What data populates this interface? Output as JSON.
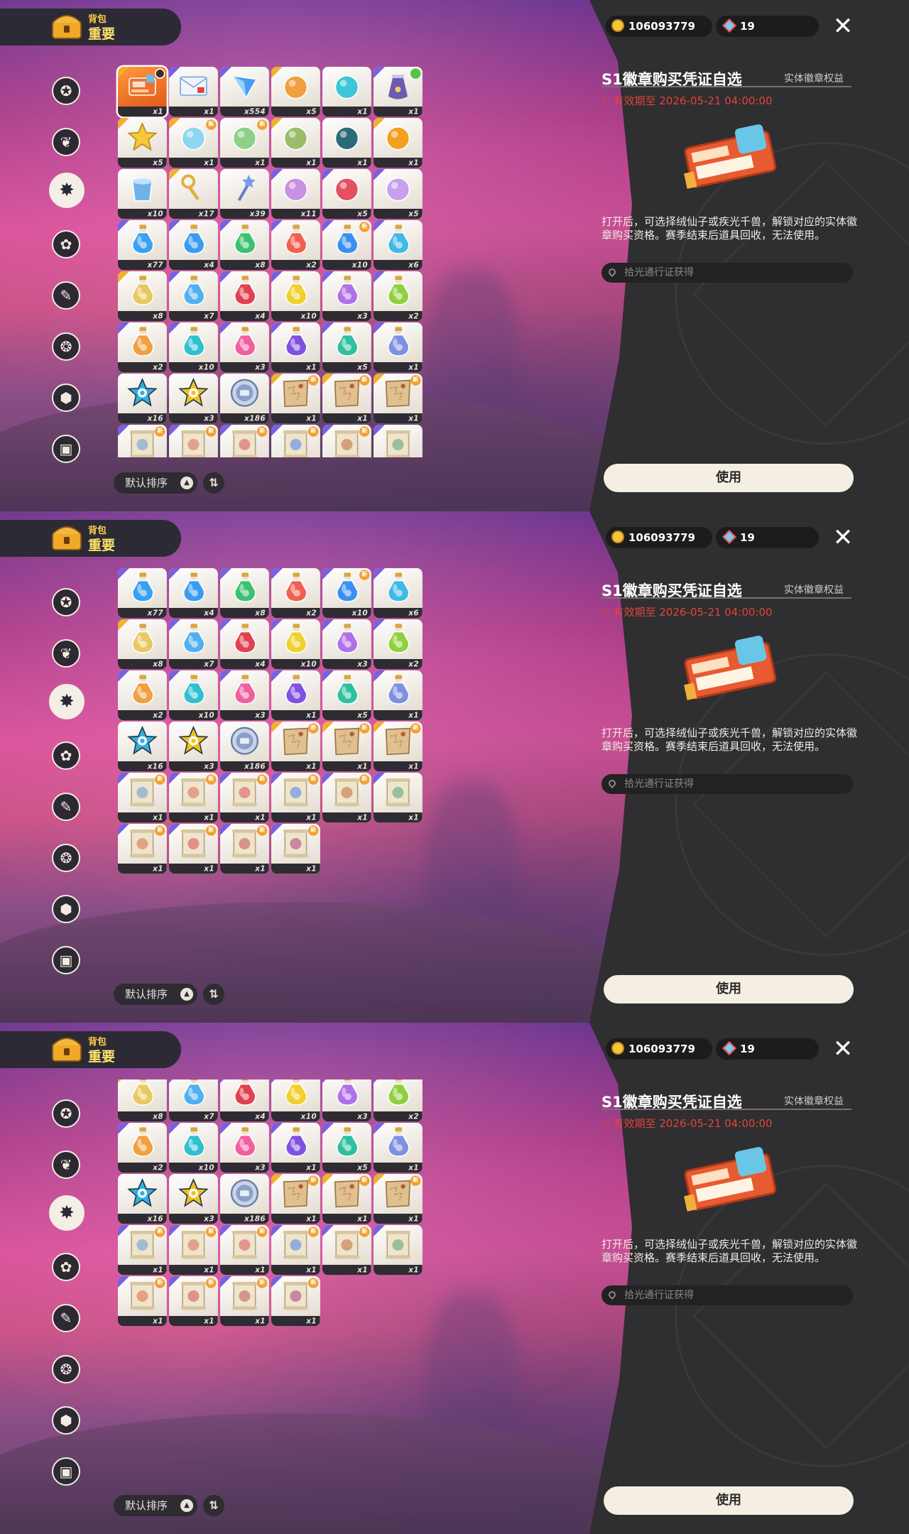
{
  "header": {
    "small": "背包",
    "big": "重要"
  },
  "currency": {
    "gold": "106093779",
    "gems": "19"
  },
  "sidebar": {
    "icons": [
      "star-badge-icon",
      "leaf-icon",
      "sparkle-burst-icon",
      "flower-icon",
      "feather-scroll-icon",
      "paw-ball-icon",
      "acorn-icon",
      "chest-icon"
    ],
    "active_index": 2
  },
  "sort": {
    "label": "默认排序",
    "dir_symbol": "⇅",
    "tri": "▲"
  },
  "detail": {
    "title": "S1徽章购买凭证自选",
    "type": "实体徽章权益",
    "expire": "有效期至 2026-05-21 04:00:00",
    "description": "打开后，可选择绒仙子或疾光千兽，解锁对应的实体徽章购买资格。赛季结束后道具回收，无法使用。",
    "source": "拾光通行证获得",
    "use_label": "使用",
    "close_symbol": "✕"
  },
  "colors": {
    "accent_red": "#e0453a",
    "panel_dark": "#2f2e30",
    "purple_corner": "#7b5fe0",
    "gold_corner": "#f0b030"
  },
  "rows": [
    [
      {
        "icon": "ticket",
        "qty": "x1",
        "corner": "gold",
        "badge": "lock",
        "sel": true,
        "color": "#e8643a"
      },
      {
        "icon": "envelope",
        "qty": "x1",
        "corner": "purple",
        "color": "#6aa9e8"
      },
      {
        "icon": "crystal",
        "qty": "x554",
        "corner": "purple",
        "color": "#4a9cf0"
      },
      {
        "icon": "badge-orange",
        "qty": "x5",
        "corner": "gold",
        "color": "#f0a040"
      },
      {
        "icon": "flask-teal",
        "qty": "x1",
        "corner": "",
        "color": "#3cc6d8"
      },
      {
        "icon": "sack",
        "qty": "x1",
        "corner": "purple",
        "badge": "green",
        "color": "#6e5ab0"
      }
    ],
    [
      {
        "icon": "star",
        "qty": "x5",
        "corner": "gold",
        "color": "#f5c83a"
      },
      {
        "icon": "crown-bowl",
        "qty": "x1",
        "corner": "gold",
        "badge": "new",
        "color": "#8fd6f0"
      },
      {
        "icon": "orb-green",
        "qty": "x1",
        "corner": "",
        "badge": "new",
        "color": "#8ed08a"
      },
      {
        "icon": "crown",
        "qty": "x1",
        "corner": "gold",
        "color": "#9bbd6a"
      },
      {
        "icon": "shell",
        "qty": "x1",
        "corner": "",
        "color": "#2b6b78"
      },
      {
        "icon": "sunflower",
        "qty": "x1",
        "corner": "gold",
        "color": "#f3a020"
      }
    ],
    [
      {
        "icon": "bucket",
        "qty": "x10",
        "corner": "",
        "color": "#6fb2ea"
      },
      {
        "icon": "key",
        "qty": "x17",
        "corner": "gold",
        "color": "#e0b040"
      },
      {
        "icon": "wand",
        "qty": "x39",
        "corner": "",
        "color": "#7a9ae8"
      },
      {
        "icon": "potion-rainbow",
        "qty": "x11",
        "corner": "purple",
        "color": "#c890e0"
      },
      {
        "icon": "potion-red",
        "qty": "x5",
        "corner": "purple",
        "color": "#e45060"
      },
      {
        "icon": "potion-crystal",
        "qty": "x5",
        "corner": "purple",
        "color": "#c8a0f0"
      }
    ],
    [
      {
        "icon": "bottle",
        "qty": "x77",
        "corner": "purple",
        "color": "#3aa0f0"
      },
      {
        "icon": "bottle",
        "qty": "x4",
        "corner": "purple",
        "color": "#3a9cf0"
      },
      {
        "icon": "bottle",
        "qty": "x8",
        "corner": "purple",
        "color": "#3ec070"
      },
      {
        "icon": "bottle",
        "qty": "x2",
        "corner": "purple",
        "color": "#f06050"
      },
      {
        "icon": "bottle",
        "qty": "x10",
        "corner": "purple",
        "badge": "new",
        "color": "#3a90f0"
      },
      {
        "icon": "bottle",
        "qty": "x6",
        "corner": "purple",
        "color": "#40b8e8"
      }
    ],
    [
      {
        "icon": "bottle",
        "qty": "x8",
        "corner": "gold",
        "color": "#e8c860"
      },
      {
        "icon": "bottle",
        "qty": "x7",
        "corner": "purple",
        "color": "#50b0f0"
      },
      {
        "icon": "bottle",
        "qty": "x4",
        "corner": "purple",
        "color": "#e04050"
      },
      {
        "icon": "bottle",
        "qty": "x10",
        "corner": "purple",
        "color": "#f0d030"
      },
      {
        "icon": "bottle",
        "qty": "x3",
        "corner": "purple",
        "color": "#b070e8"
      },
      {
        "icon": "bottle",
        "qty": "x2",
        "corner": "purple",
        "color": "#90d040"
      }
    ],
    [
      {
        "icon": "bottle",
        "qty": "x2",
        "corner": "purple",
        "color": "#f0a040"
      },
      {
        "icon": "bottle",
        "qty": "x10",
        "corner": "purple",
        "color": "#30c0d0"
      },
      {
        "icon": "bottle",
        "qty": "x3",
        "corner": "purple",
        "color": "#f060a0"
      },
      {
        "icon": "bottle",
        "qty": "x1",
        "corner": "purple",
        "color": "#8050e0"
      },
      {
        "icon": "bottle",
        "qty": "x5",
        "corner": "purple",
        "color": "#30c0a0"
      },
      {
        "icon": "bottle",
        "qty": "x1",
        "corner": "purple",
        "color": "#8090e0"
      }
    ],
    [
      {
        "icon": "star-c",
        "qty": "x16",
        "corner": "",
        "color": "#30b0e0"
      },
      {
        "icon": "star-c",
        "qty": "x3",
        "corner": "",
        "color": "#f0c020"
      },
      {
        "icon": "coin-silver",
        "qty": "x186",
        "corner": "",
        "color": "#8aa0c8"
      },
      {
        "icon": "map",
        "qty": "x1",
        "corner": "gold",
        "badge": "new",
        "color": "#c89860"
      },
      {
        "icon": "map",
        "qty": "x1",
        "corner": "gold",
        "badge": "new",
        "color": "#c89860"
      },
      {
        "icon": "map",
        "qty": "x1",
        "corner": "gold",
        "badge": "new",
        "color": "#c89860"
      }
    ],
    [
      {
        "icon": "scroll",
        "qty": "x1",
        "corner": "purple",
        "badge": "new",
        "color": "#90b0d0"
      },
      {
        "icon": "scroll",
        "qty": "x1",
        "corner": "purple",
        "badge": "new",
        "color": "#e0907a"
      },
      {
        "icon": "scroll",
        "qty": "x1",
        "corner": "purple",
        "badge": "new",
        "color": "#e08080"
      },
      {
        "icon": "scroll",
        "qty": "x1",
        "corner": "purple",
        "badge": "new",
        "color": "#7aa0e0"
      },
      {
        "icon": "scroll",
        "qty": "x1",
        "corner": "purple",
        "badge": "new",
        "color": "#d09060"
      },
      {
        "icon": "scroll",
        "qty": "x1",
        "corner": "purple",
        "color": "#80b890"
      }
    ],
    [
      {
        "icon": "scroll",
        "qty": "x1",
        "corner": "purple",
        "badge": "new",
        "color": "#e09070"
      },
      {
        "icon": "scroll",
        "qty": "x1",
        "corner": "purple",
        "badge": "new",
        "color": "#e07a7a"
      },
      {
        "icon": "scroll",
        "qty": "x1",
        "corner": "purple",
        "badge": "new",
        "color": "#d08080"
      },
      {
        "icon": "scroll",
        "qty": "x1",
        "corner": "purple",
        "badge": "new",
        "color": "#c07090"
      }
    ]
  ]
}
